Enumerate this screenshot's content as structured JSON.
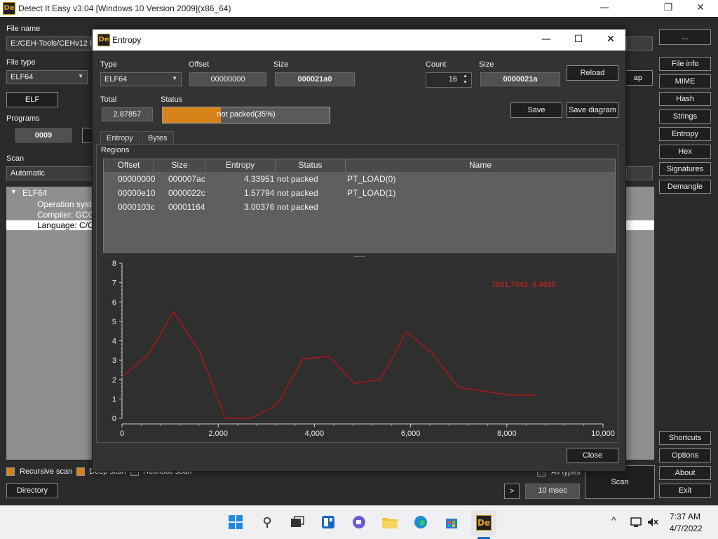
{
  "main_window": {
    "title": "Detect It Easy v3.04 [Windows 10 Version 2009](x86_64)",
    "logo_text": "De",
    "file_name_label": "File name",
    "file_name_value": "E:/CEH-Tools/CEHv12 M",
    "browse_label": "...",
    "file_type_label": "File type",
    "file_type_value": "ELF64",
    "elf_button": "ELF",
    "programs_label": "Programs",
    "programs_value": "0009",
    "hidden_button_partial": "ap",
    "scan_label": "Scan",
    "scan_mode": "Automatic",
    "tree": {
      "root": "ELF64",
      "items": [
        "Operation syst",
        "Compiler: GCC",
        "Language: C/C"
      ]
    },
    "recursive_scan_label": "Recursive scan",
    "deep_scan_label": "Deep scan",
    "heuristic_scan_label": "Heuristic scan",
    "all_types_label": "All types",
    "directory_button": "Directory",
    "arrow_button": ">",
    "time_value": "10 msec",
    "scan_button": "Scan",
    "right_buttons": [
      "File info",
      "MIME",
      "Hash",
      "Strings",
      "Entropy",
      "Hex",
      "Signatures",
      "Demangle"
    ],
    "bottom_right_buttons": [
      "Shortcuts",
      "Options",
      "About",
      "Exit"
    ]
  },
  "entropy_dialog": {
    "title": "Entropy",
    "type_label": "Type",
    "type_value": "ELF64",
    "offset_label": "Offset",
    "offset_value": "00000000",
    "size_label": "Size",
    "size_value": "000021a0",
    "count_label": "Count",
    "count_value": "16",
    "size2_label": "Size",
    "size2_value": "0000021a",
    "reload_button": "Reload",
    "total_label": "Total",
    "total_value": "2.87857",
    "status_label": "Status",
    "status_text": "not packed(35%)",
    "status_percent": 35,
    "save_button": "Save",
    "save_diagram_button": "Save diagram",
    "tabs": [
      "Entropy",
      "Bytes"
    ],
    "regions_label": "Regions",
    "columns": [
      "Offset",
      "Size",
      "Entropy",
      "Status",
      "Name"
    ],
    "rows": [
      [
        "00000000",
        "000007ac",
        "4.33951",
        "not packed",
        "PT_LOAD(0)"
      ],
      [
        "00000e10",
        "0000022c",
        "1.57794",
        "not packed",
        "PT_LOAD(1)"
      ],
      [
        "0000103c",
        "00001164",
        "3.00376",
        "not packed",
        ""
      ]
    ],
    "splitter_handle": "......",
    "close_button": "Close"
  },
  "chart_data": {
    "type": "line",
    "x": [
      0,
      537,
      1075,
      1612,
      2150,
      2687,
      3225,
      3762,
      4300,
      4837,
      5375,
      5912,
      6450,
      6987,
      7525,
      8062,
      8600
    ],
    "y": [
      2.15,
      3.25,
      5.5,
      3.45,
      0.0,
      0.0,
      0.7,
      3.05,
      3.2,
      1.8,
      2.0,
      4.45,
      3.35,
      1.6,
      1.4,
      1.2,
      1.2
    ],
    "xlim": [
      0,
      10000
    ],
    "ylim": [
      0,
      8
    ],
    "x_ticks": [
      "0",
      "2,000",
      "4,000",
      "6,000",
      "8,000",
      "10,000"
    ],
    "y_ticks": [
      "0",
      "1",
      "2",
      "3",
      "4",
      "5",
      "6",
      "7",
      "8"
    ],
    "annotation": "7601.7442, 6.4865",
    "line_color": "#cc1111",
    "annotation_color": "#e02020"
  },
  "taskbar": {
    "time": "7:37 AM",
    "date": "4/7/2022",
    "chevron": "^"
  },
  "colors": {
    "accent": "#d8821a",
    "background": "#2b2b2b",
    "dialog_bg": "#333333"
  }
}
